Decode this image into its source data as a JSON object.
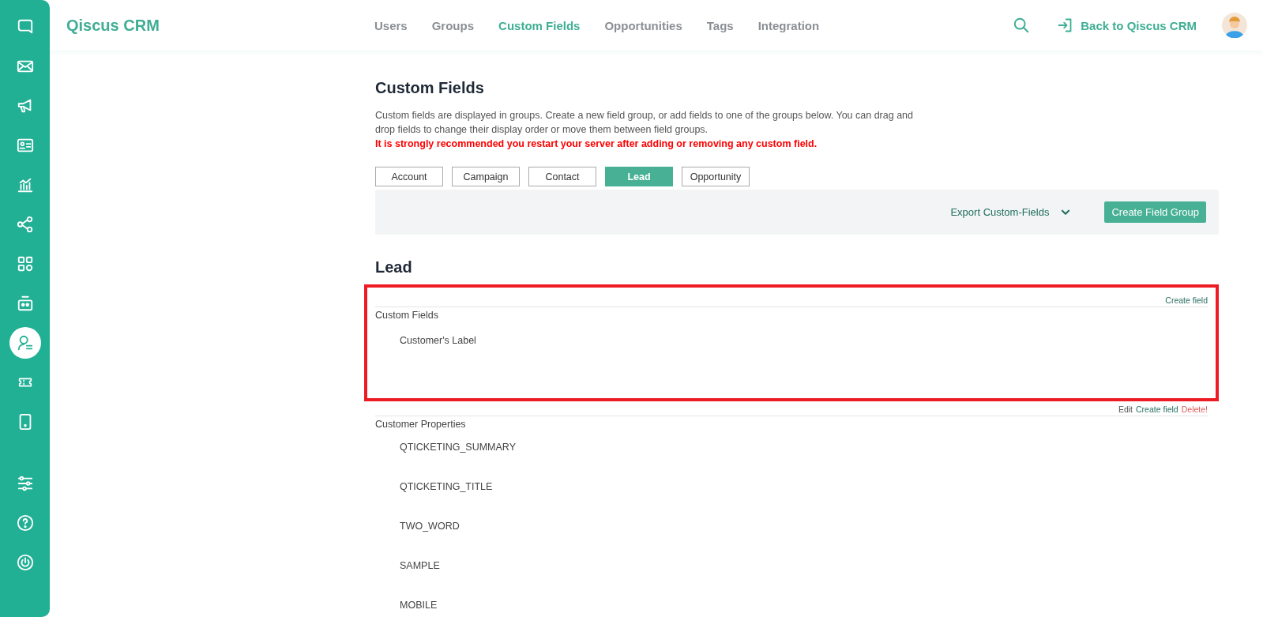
{
  "sidebar": {
    "items": [
      {
        "selected": false
      },
      {
        "selected": false
      },
      {
        "selected": false
      },
      {
        "selected": false
      },
      {
        "selected": false
      },
      {
        "selected": false
      },
      {
        "selected": false
      },
      {
        "selected": false
      },
      {
        "selected": true
      },
      {
        "selected": false
      },
      {
        "selected": false
      }
    ],
    "bottom_items": [
      {
        "selected": false
      },
      {
        "selected": false
      },
      {
        "selected": false
      }
    ]
  },
  "header": {
    "brand": "Qiscus CRM",
    "nav": [
      {
        "label": "Users",
        "selected": false
      },
      {
        "label": "Groups",
        "selected": false
      },
      {
        "label": "Custom Fields",
        "selected": true
      },
      {
        "label": "Opportunities",
        "selected": false
      },
      {
        "label": "Tags",
        "selected": false
      },
      {
        "label": "Integration",
        "selected": false
      }
    ],
    "back_link": "Back to Qiscus CRM"
  },
  "page": {
    "title": "Custom Fields",
    "description": "Custom fields are displayed in groups. Create a new field group, or add fields to one of the groups below. You can drag and drop fields to change their display order or move them between field groups.",
    "warning": "It is strongly recommended you restart your server after adding or removing any custom field.",
    "tabs": [
      {
        "label": "Account",
        "selected": false
      },
      {
        "label": "Campaign",
        "selected": false
      },
      {
        "label": "Contact",
        "selected": false
      },
      {
        "label": "Lead",
        "selected": true
      },
      {
        "label": "Opportunity",
        "selected": false
      }
    ],
    "toolbar": {
      "export": "Export Custom-Fields",
      "create_group": "Create Field Group"
    },
    "section_title": "Lead",
    "groups": [
      {
        "title": "Custom Fields",
        "highlighted": true,
        "actions": [
          {
            "kind": "create",
            "label": "Create field"
          }
        ],
        "fields": [
          "Customer's Label"
        ]
      },
      {
        "title": "Customer Properties",
        "highlighted": false,
        "actions": [
          {
            "kind": "edit",
            "label": "Edit"
          },
          {
            "kind": "create",
            "label": "Create field"
          },
          {
            "kind": "delete",
            "label": "Delete!"
          }
        ],
        "fields": [
          "QTICKETING_SUMMARY",
          "QTICKETING_TITLE",
          "TWO_WORD",
          "SAMPLE",
          "MOBILE"
        ]
      }
    ]
  }
}
